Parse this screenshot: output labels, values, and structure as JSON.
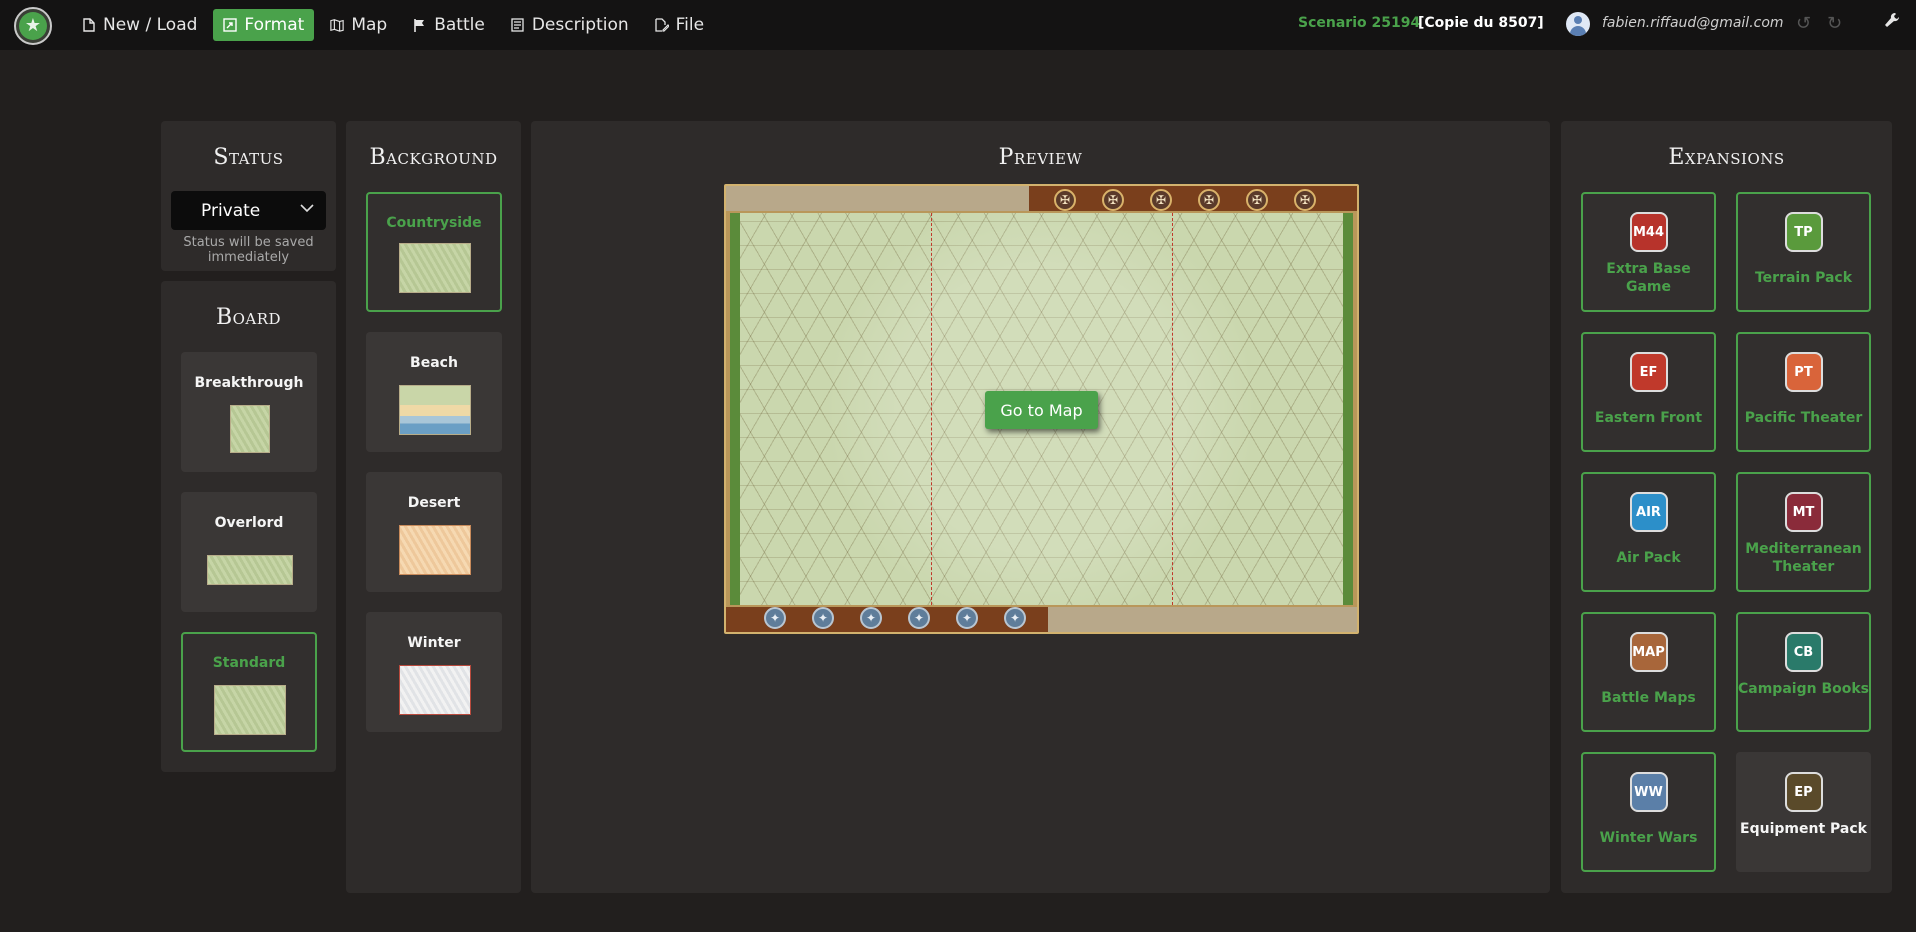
{
  "nav": {
    "new_load": "New / Load",
    "format": "Format",
    "map": "Map",
    "battle": "Battle",
    "description": "Description",
    "file": "File"
  },
  "header": {
    "scenario": "Scenario 25194",
    "copy": "[Copie du 8507]",
    "email": "fabien.riffaud@gmail.com"
  },
  "status": {
    "title": "Status",
    "value": "Private",
    "note": "Status will be saved immediately"
  },
  "board": {
    "title": "Board",
    "items": [
      {
        "label": "Breakthrough",
        "selected": false
      },
      {
        "label": "Overlord",
        "selected": false
      },
      {
        "label": "Standard",
        "selected": true
      }
    ]
  },
  "background": {
    "title": "Background",
    "items": [
      {
        "label": "Countryside",
        "selected": true
      },
      {
        "label": "Beach",
        "selected": false
      },
      {
        "label": "Desert",
        "selected": false
      },
      {
        "label": "Winter",
        "selected": false
      }
    ]
  },
  "preview": {
    "title": "Preview",
    "goto_map": "Go to Map"
  },
  "expansions": {
    "title": "Expansions",
    "items": [
      {
        "badge": "M44",
        "label": "Extra Base Game",
        "selected": true,
        "color": "#b7332b"
      },
      {
        "badge": "TP",
        "label": "Terrain Pack",
        "selected": true,
        "color": "#5a9a3c"
      },
      {
        "badge": "EF",
        "label": "Eastern Front",
        "selected": true,
        "color": "#c0392b"
      },
      {
        "badge": "PT",
        "label": "Pacific Theater",
        "selected": true,
        "color": "#d9643a"
      },
      {
        "badge": "AIR",
        "label": "Air Pack",
        "selected": true,
        "color": "#2c8fc9"
      },
      {
        "badge": "MT",
        "label": "Mediterranean Theater",
        "selected": true,
        "color": "#8a2b3a"
      },
      {
        "badge": "MAP",
        "label": "Battle Maps",
        "selected": true,
        "color": "#a8663a"
      },
      {
        "badge": "CB",
        "label": "Campaign Books",
        "selected": true,
        "color": "#2a7a6a"
      },
      {
        "badge": "WW",
        "label": "Winter Wars",
        "selected": true,
        "color": "#5b7fa8"
      },
      {
        "badge": "EP",
        "label": "Equipment Pack",
        "selected": false,
        "color": "#5a4a2a"
      }
    ]
  },
  "colors": {
    "accent": "#4aa24b",
    "background": "#221f1e",
    "panel": "#2e2b2a",
    "topbar": "#141313"
  }
}
